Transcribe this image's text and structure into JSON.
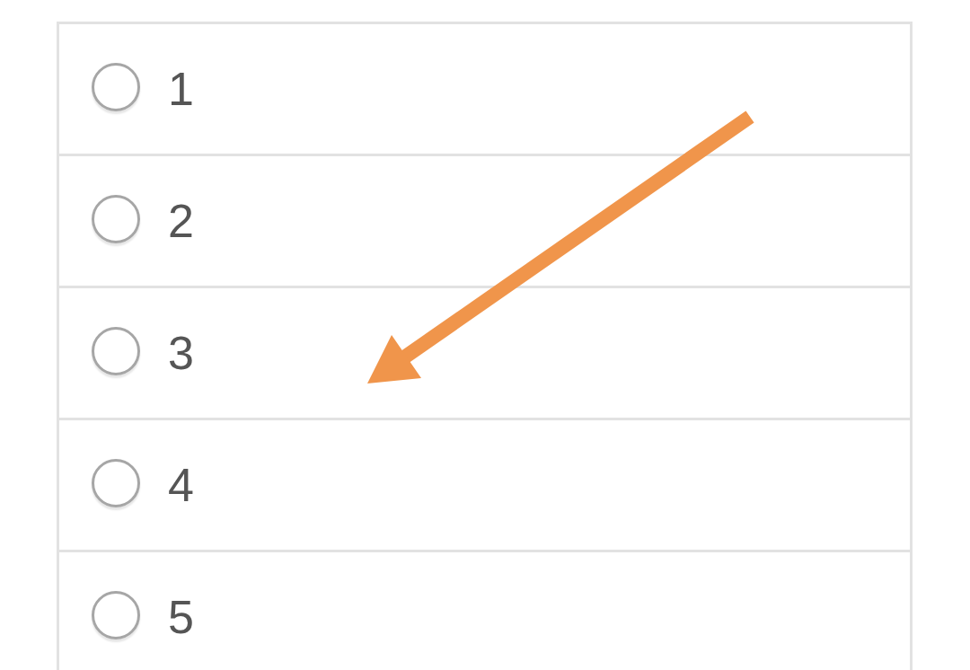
{
  "options": [
    {
      "label": "1",
      "selected": false
    },
    {
      "label": "2",
      "selected": false
    },
    {
      "label": "3",
      "selected": false
    },
    {
      "label": "4",
      "selected": false
    },
    {
      "label": "5",
      "selected": false
    }
  ]
}
